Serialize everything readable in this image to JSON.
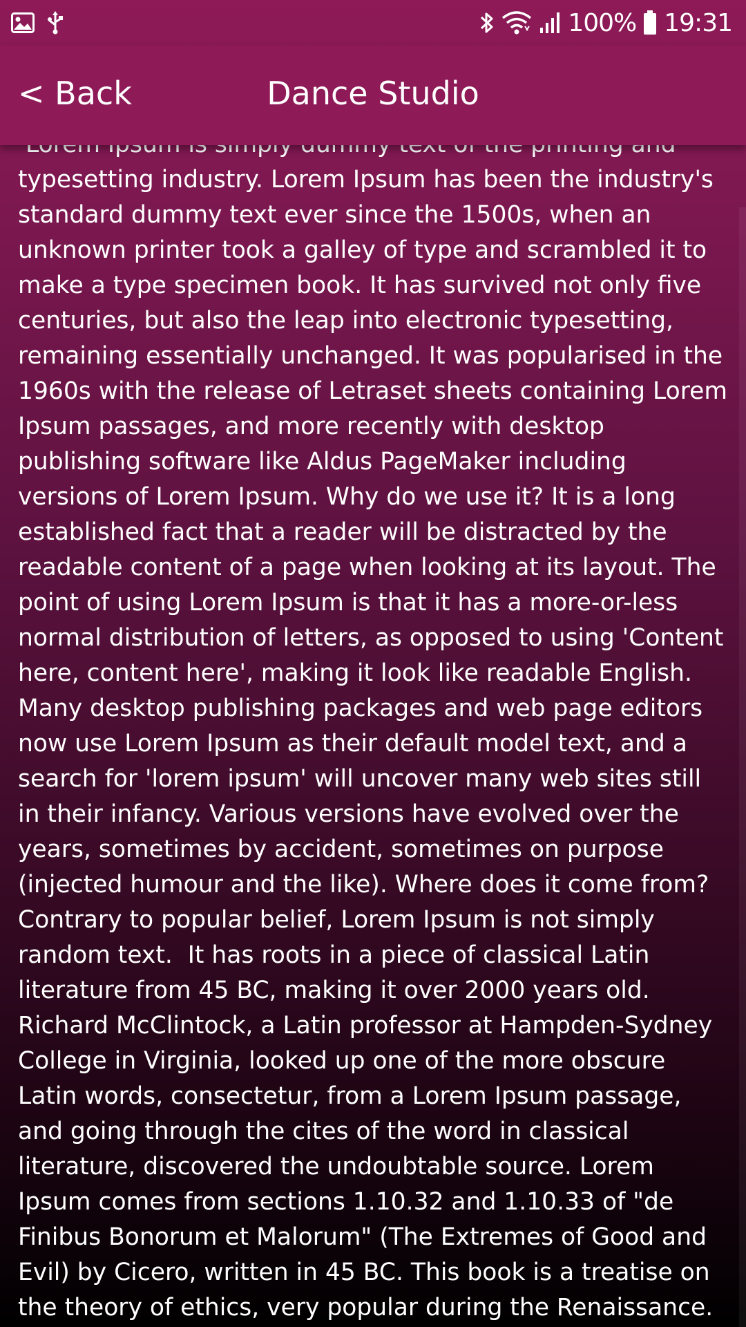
{
  "status_bar": {
    "battery": "100%",
    "time": "19:31",
    "icons": [
      "image-icon",
      "usb-icon",
      "bluetooth-icon",
      "wifi-icon",
      "signal-icon",
      "battery-icon"
    ]
  },
  "header": {
    "back_label": "< Back",
    "title": "Dance Studio",
    "background_color": "#8e1a57"
  },
  "article": {
    "body": " Lorem Ipsum is simply dummy text of the printing and typesetting industry. Lorem Ipsum has been the industry's standard dummy text ever since the 1500s, when an unknown printer took a galley of type and scrambled it to make a type specimen book. It has survived not only five centuries, but also the leap into electronic typesetting, remaining essentially unchanged. It was popularised in the 1960s with the release of Letraset sheets containing Lorem Ipsum passages, and more recently with desktop publishing software like Aldus PageMaker including versions of Lorem Ipsum. Why do we use it? It is a long established fact that a reader will be distracted by the readable content of a page when looking at its layout. The point of using Lorem Ipsum is that it has a more-or-less normal distribution of letters, as opposed to using 'Content here, content here', making it look like readable English. Many desktop publishing packages and web page editors now use Lorem Ipsum as their default model text, and a search for 'lorem ipsum' will uncover many web sites still in their infancy. Various versions have evolved over the years, sometimes by accident, sometimes on purpose (injected humour and the like). Where does it come from? Contrary to popular belief, Lorem Ipsum is not simply random text.  It has roots in a piece of classical Latin literature from 45 BC, making it over 2000 years old. Richard McClintock, a Latin professor at Hampden-Sydney College in Virginia, looked up one of the more obscure Latin words, consectetur, from a Lorem Ipsum passage, and going through the cites of the word in classical literature, discovered the undoubtable source. Lorem Ipsum comes from sections 1.10.32 and 1.10.33 of \"de Finibus Bonorum et Malorum\" (The Extremes of Good and Evil) by Cicero, written in 45 BC. This book is a treatise on the theory of ethics, very popular during the Renaissance. The first line"
  }
}
